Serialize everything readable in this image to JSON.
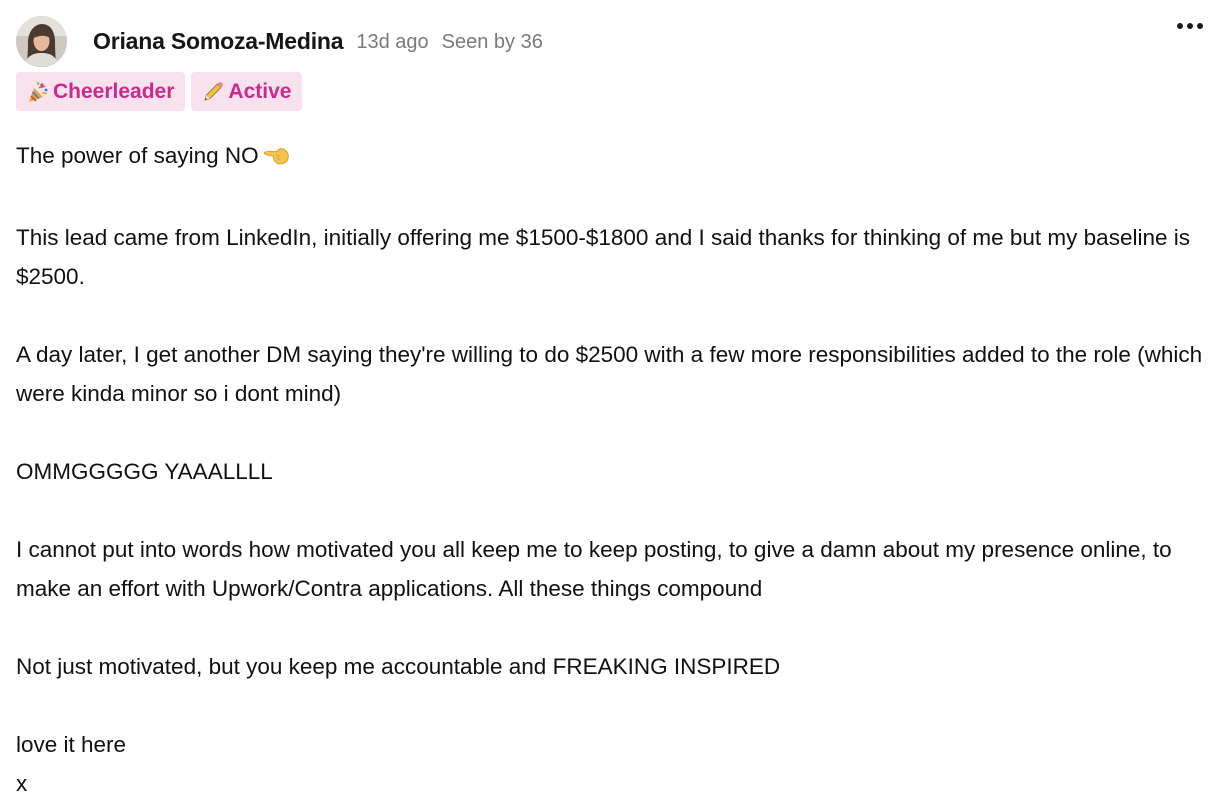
{
  "post": {
    "author": {
      "name": "Oriana Somoza-Medina",
      "avatar_icon": "user-avatar"
    },
    "time_ago": "13d ago",
    "seen_by": "Seen by 36",
    "more_icon": "ellipsis-icon",
    "badges": [
      {
        "icon": "party-popper-icon",
        "label": "Cheerleader"
      },
      {
        "icon": "pencil-icon",
        "label": "Active"
      }
    ],
    "accent_color": "#cc2a8a",
    "badge_background": "#f8e2ee",
    "body": {
      "p1": "The power of saying NO",
      "p1_emoji": "pointing-hand-emoji",
      "p2": "This lead came from LinkedIn, initially offering me $1500-$1800 and I said thanks for thinking of me but my baseline is $2500.",
      "p3": "A day later, I get another DM saying they're willing to do $2500 with a few more responsibilities added to the role (which were kinda minor so i dont mind)",
      "p4": "OMMGGGGG YAAALLLL",
      "p5": "I cannot put into words how motivated you all keep me to keep posting, to give a damn about my presence online, to make an effort with Upwork/Contra applications. All these things compound",
      "p6": "Not just motivated, but you keep me accountable and FREAKING INSPIRED",
      "p7_line1": "love it here",
      "p7_line2": "x"
    }
  }
}
